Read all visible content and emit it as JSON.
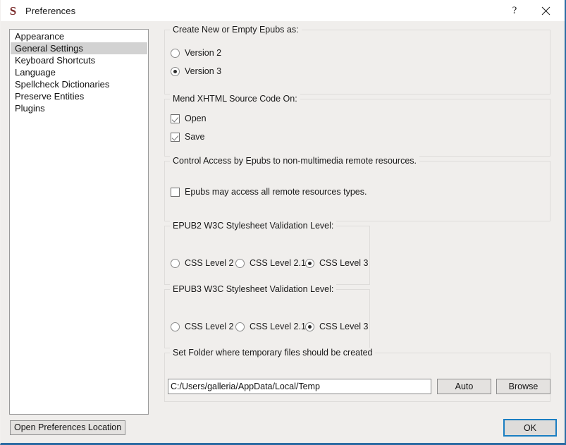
{
  "window": {
    "title": "Preferences",
    "logo_glyph": "S",
    "help_label": "?",
    "close_label": "×",
    "accent_color": "#2b6ca3",
    "background_color": "#f0eeec"
  },
  "sidebar": {
    "items": [
      {
        "label": "Appearance",
        "selected": false
      },
      {
        "label": "General Settings",
        "selected": true
      },
      {
        "label": "Keyboard Shortcuts",
        "selected": false
      },
      {
        "label": "Language",
        "selected": false
      },
      {
        "label": "Spellcheck Dictionaries",
        "selected": false
      },
      {
        "label": "Preserve Entities",
        "selected": false
      },
      {
        "label": "Plugins",
        "selected": false
      }
    ],
    "open_prefs_button": "Open Preferences Location"
  },
  "groups": {
    "create_epubs": {
      "title": "Create New or Empty Epubs as:",
      "options": [
        {
          "label": "Version 2",
          "checked": false
        },
        {
          "label": "Version 3",
          "checked": true
        }
      ]
    },
    "mend_xhtml": {
      "title": "Mend XHTML Source Code On:",
      "options": [
        {
          "label": "Open",
          "checked": true
        },
        {
          "label": "Save",
          "checked": true
        }
      ]
    },
    "remote_access": {
      "title": "Control Access by Epubs to non-multimedia remote resources.",
      "options": [
        {
          "label": "Epubs may access all remote resources types.",
          "checked": false
        }
      ]
    },
    "epub2_css": {
      "title": "EPUB2 W3C Stylesheet Validation Level:",
      "options": [
        {
          "label": "CSS Level 2",
          "checked": false
        },
        {
          "label": "CSS Level 2.1",
          "checked": false
        },
        {
          "label": "CSS Level 3",
          "checked": true
        }
      ]
    },
    "epub3_css": {
      "title": "EPUB3 W3C Stylesheet Validation Level:",
      "options": [
        {
          "label": "CSS Level 2",
          "checked": false
        },
        {
          "label": "CSS Level 2.1",
          "checked": false
        },
        {
          "label": "CSS Level 3",
          "checked": true
        }
      ]
    },
    "temp_folder": {
      "title": "Set Folder where temporary files should be created",
      "path_value": "C:/Users/galleria/AppData/Local/Temp",
      "path_placeholder": "",
      "auto_button": "Auto",
      "browse_button": "Browse"
    }
  },
  "footer": {
    "ok_button": "OK"
  }
}
